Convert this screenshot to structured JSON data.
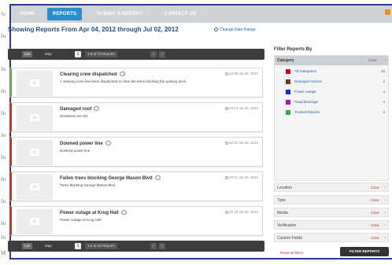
{
  "nav": {
    "items": [
      {
        "label": "HOME",
        "active": false
      },
      {
        "label": "REPORTS",
        "active": true
      },
      {
        "label": "SUBMIT A REPORT",
        "active": false
      },
      {
        "label": "CONTACT US",
        "active": false
      }
    ]
  },
  "heading": {
    "title": "Showing Reports From Apr 04, 2012 through Jul 02, 2012",
    "change_range": "Change Date Range"
  },
  "toolbar": {
    "list_label": "List",
    "map_label": "Map",
    "page": "1",
    "count": "1-5 of 10 Reports",
    "prev": "‹",
    "next": "›"
  },
  "toolbar_bottom": {
    "list_label": "List",
    "map_label": "Map",
    "page": "1",
    "count": "1-5 of 10 Reports",
    "prev": "‹",
    "next": "›"
  },
  "reports": [
    {
      "title": "Clearing crew dispatched",
      "desc": "A clearing crew has been dispatched to clear the trees blocking the parking deck.",
      "date": "10:36 Jul 02, 2012",
      "status": "green"
    },
    {
      "title": "Damaged roof",
      "desc": "Residents are OK",
      "date": "10:24 Jul 02, 2012",
      "status": "red"
    },
    {
      "title": "Downed power line",
      "desc": "Downed power line",
      "date": "10:22 Jul 02, 2012",
      "status": "red"
    },
    {
      "title": "Fallen trees blocking George Mason Blvd",
      "desc": "Trees blocking George Mason Blvd",
      "date": "10:21 Jul 02, 2012",
      "status": "red"
    },
    {
      "title": "Power outage at Krug Hall",
      "desc": "Power outage at Krug Hall",
      "date": "10:18 Jul 02, 2012",
      "status": "red"
    }
  ],
  "filter": {
    "title": "Filter Reports By",
    "category_label": "Category",
    "clear_label": "Clear",
    "categories": [
      {
        "name": "All Categories",
        "count": "10",
        "color": "#d0021b"
      },
      {
        "name": "Damaged Homes",
        "count": "2",
        "color": "#6b3a1f"
      },
      {
        "name": "Power outage",
        "count": "4",
        "color": "#1f1fe0"
      },
      {
        "name": "Road blockage",
        "count": "4",
        "color": "#9b1fc0"
      },
      {
        "name": "Trusted Reports",
        "count": "0",
        "color": "#3aa83a"
      }
    ],
    "sections": [
      "Location",
      "Type",
      "Media",
      "Verification",
      "Custom Fields"
    ],
    "reset_label": "Reset all filters",
    "button_label": "FILTER REPORTS"
  },
  "background_letters": [
    "Ju",
    "Ju",
    "Ju",
    "Ju",
    "Ju",
    "Ju",
    "Ju",
    "Ju",
    "Ju",
    "Ju",
    "Ju",
    "M"
  ]
}
